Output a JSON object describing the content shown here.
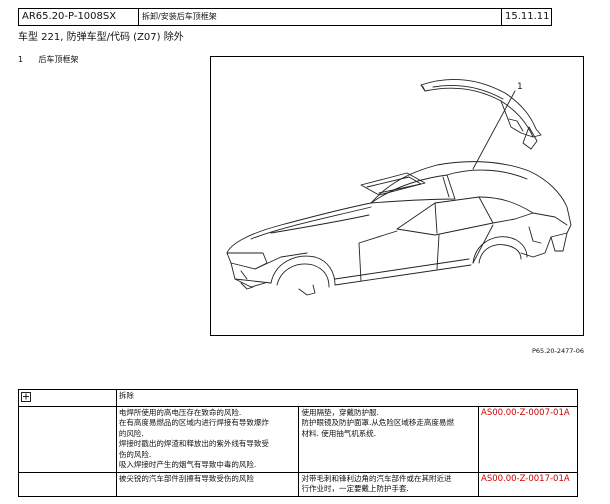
{
  "header": {
    "doc_id": "AR65.20-P-1008SX",
    "title": "拆卸/安装后车顶框架",
    "date": "15.11.11"
  },
  "model_line": "车型  221, 防弹车型/代码 (Z07) 除外",
  "items": [
    {
      "number": "1",
      "label": "后车顶框架"
    }
  ],
  "figure": {
    "callout": "1",
    "code": "P65.20-2477-06"
  },
  "table": {
    "header_label": "拆除",
    "rows": [
      {
        "risk_lines": [
          "电焊所使用的高电压存在致命的风险.",
          "在有高度易燃品的区域内进行焊接有导致爆炸",
          "的风险.",
          "焊接时戳出的焊渣和释放出的紫外线有导致受",
          "伤的风险.",
          "吸入焊接时产生的烟气有导致中毒的风险."
        ],
        "measure_lines": [
          "使用隔垫，穿戴防护服.",
          "防护眼镜及防护面罩.从危险区域移走高度易燃",
          "材料. 使用抽气机系统."
        ],
        "ref": "AS00.00-Z-0007-01A"
      },
      {
        "risk_lines": [
          "被尖锐的汽车部件刮擦有导致受伤的风险"
        ],
        "measure_lines": [
          "对带毛刺和锋利边角的汽车部件或在其附近进",
          "行作业时，一定要戴上防护手套."
        ],
        "ref": "AS00.00-Z-0017-01A"
      }
    ]
  }
}
